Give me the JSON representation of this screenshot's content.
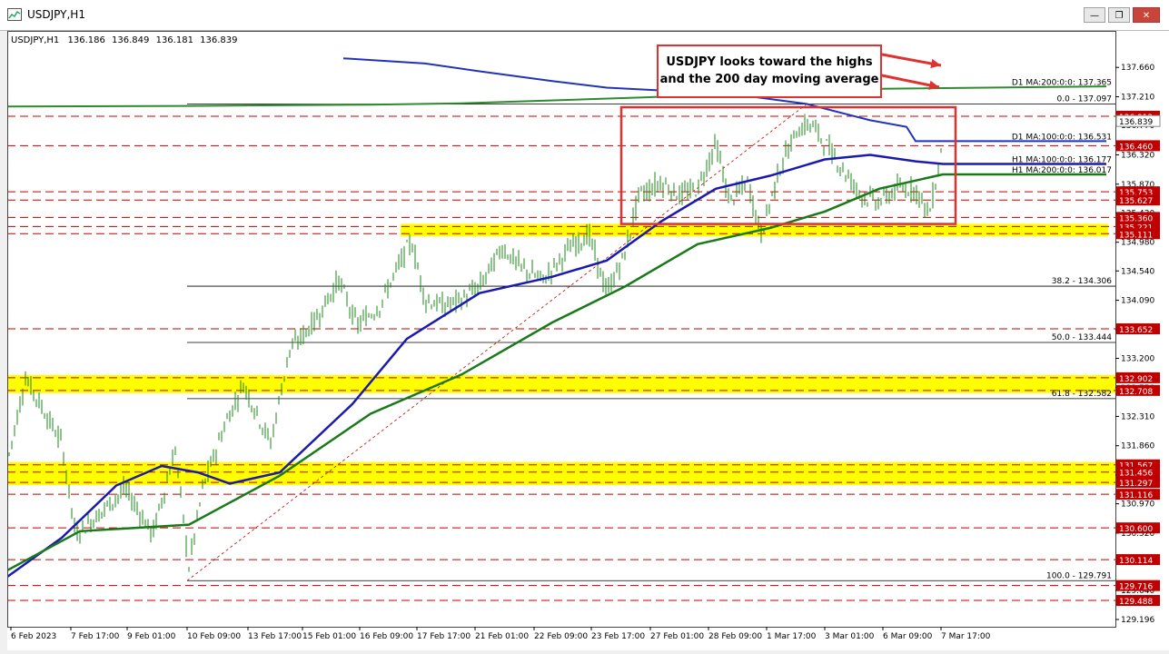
{
  "window": {
    "title": "USDJPY,H1",
    "buttons": [
      "minimize",
      "restore",
      "close"
    ]
  },
  "chart_data": {
    "type": "line",
    "symbol_header": {
      "symbol": "USDJPY,H1",
      "values": [
        "136.186",
        "136.849",
        "136.181",
        "136.839"
      ]
    },
    "callout": {
      "line1": "USDJPY looks toward the highs",
      "line2": "and the 200 day moving average"
    },
    "ylim": [
      129.196,
      137.9
    ],
    "y_ticks": [
      "137.660",
      "137.210",
      "136.770",
      "136.320",
      "135.870",
      "135.430",
      "134.980",
      "134.540",
      "134.090",
      "133.640",
      "133.200",
      "132.750",
      "132.310",
      "131.860",
      "131.410",
      "130.970",
      "130.520",
      "130.080",
      "129.640",
      "129.196"
    ],
    "x_labels": [
      "6 Feb 2023",
      "7 Feb 17:00",
      "9 Feb 01:00",
      "10 Feb 09:00",
      "13 Feb 17:00",
      "15 Feb 01:00",
      "16 Feb 09:00",
      "17 Feb 17:00",
      "21 Feb 01:00",
      "22 Feb 09:00",
      "23 Feb 17:00",
      "27 Feb 01:00",
      "28 Feb 09:00",
      "1 Mar 17:00",
      "3 Mar 01:00",
      "6 Mar 09:00",
      "7 Mar 17:00"
    ],
    "price_levels": [
      {
        "label": "136.912",
        "value": 136.912
      },
      {
        "label": "136.460",
        "value": 136.46
      },
      {
        "label": "135.753",
        "value": 135.753
      },
      {
        "label": "135.627",
        "value": 135.627
      },
      {
        "label": "135.360",
        "value": 135.36
      },
      {
        "label": "135.221",
        "value": 135.221
      },
      {
        "label": "135.111",
        "value": 135.111
      },
      {
        "label": "133.652",
        "value": 133.652
      },
      {
        "label": "132.902",
        "value": 132.902
      },
      {
        "label": "132.708",
        "value": 132.708
      },
      {
        "label": "131.567",
        "value": 131.567
      },
      {
        "label": "131.456",
        "value": 131.456
      },
      {
        "label": "131.297",
        "value": 131.297
      },
      {
        "label": "131.116",
        "value": 131.116
      },
      {
        "label": "130.600",
        "value": 130.6
      },
      {
        "label": "130.114",
        "value": 130.114
      },
      {
        "label": "129.716",
        "value": 129.716
      },
      {
        "label": "129.488",
        "value": 129.488
      }
    ],
    "support_zones": [
      {
        "from": 135.111,
        "to": 135.221
      },
      {
        "from": 132.708,
        "to": 132.902
      },
      {
        "from": 131.297,
        "to": 131.567
      }
    ],
    "fibonacci": [
      {
        "label": "0.0 - 137.097",
        "value": 137.097
      },
      {
        "label": "38.2 - 134.306",
        "value": 134.306
      },
      {
        "label": "50.0 - 133.444",
        "value": 133.444
      },
      {
        "label": "61.8 - 132.582",
        "value": 132.582
      },
      {
        "label": "100.0 - 129.791",
        "value": 129.791
      }
    ],
    "moving_averages": [
      {
        "label": "D1 MA:200:0:0: 137.365",
        "value": 137.365,
        "color": "#2e8b2e"
      },
      {
        "label": "D1 MA:100:0:0: 136.531",
        "value": 136.531,
        "color": "#2233bb"
      },
      {
        "label": "H1 MA:100:0:0: 136.177",
        "value": 136.177,
        "color": "#1a1ab0"
      },
      {
        "label": "H1 MA:200:0:0: 136.017",
        "value": 136.017,
        "color": "#1a7a1a"
      }
    ],
    "current_price": "136.839",
    "colors": {
      "candles": "#1a8a1a",
      "zone": "#ffff00",
      "level": "#c00000",
      "box": "#e03131"
    }
  }
}
